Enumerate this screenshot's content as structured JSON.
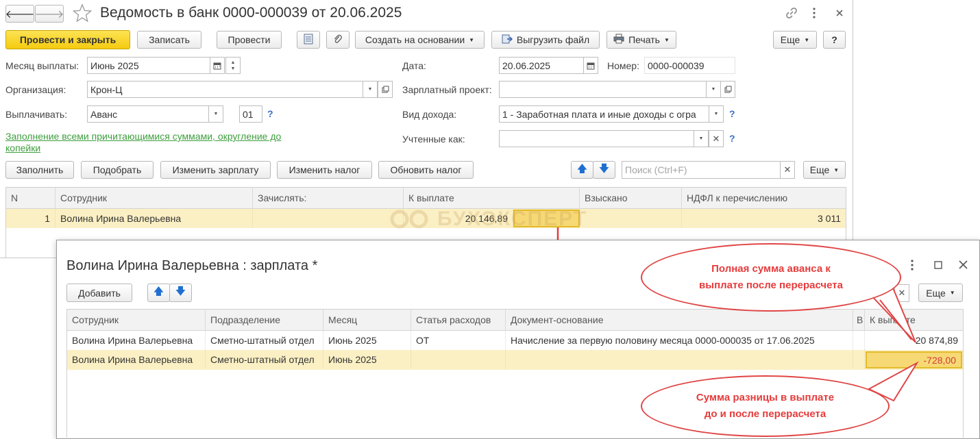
{
  "header": {
    "title": "Ведомость в банк 0000-000039 от 20.06.2025",
    "back_glyph": "🡐",
    "forward_glyph": "🡒"
  },
  "toolbar": {
    "post_close": "Провести и закрыть",
    "save": "Записать",
    "post": "Провести",
    "create_based": "Создать на основании",
    "export_file": "Выгрузить файл",
    "print": "Печать",
    "more": "Еще",
    "help": "?"
  },
  "form": {
    "pay_month_label": "Месяц выплаты:",
    "pay_month_value": "Июнь 2025",
    "org_label": "Организация:",
    "org_value": "Крон-Ц",
    "pay_label": "Выплачивать:",
    "pay_value": "Аванс",
    "pay_code": "01",
    "date_label": "Дата:",
    "date_value": "20.06.2025",
    "number_label": "Номер:",
    "number_value": "0000-000039",
    "salary_project_label": "Зарплатный проект:",
    "income_type_label": "Вид дохода:",
    "income_type_value": "1 - Заработная плата и иные доходы с огра",
    "counted_as_label": "Учтенные как:",
    "fill_link_line1": "Заполнение всеми причитающимися суммами, округление до",
    "fill_link_line2": "копейки",
    "help_q": "?"
  },
  "table_toolbar": {
    "fill": "Заполнить",
    "pick": "Подобрать",
    "change_salary": "Изменить зарплату",
    "change_tax": "Изменить налог",
    "update_tax": "Обновить налог",
    "search_placeholder": "Поиск (Ctrl+F)",
    "more": "Еще"
  },
  "table": {
    "columns": [
      "N",
      "Сотрудник",
      "Зачислять:",
      "К выплате",
      "Взыскано",
      "НДФЛ к перечислению"
    ],
    "rows": [
      {
        "n": "1",
        "employee": "Волина Ирина Валерьевна",
        "credit": "",
        "to_pay": "20 146,89",
        "withheld": "",
        "ndfl": "3 011"
      }
    ]
  },
  "watermark": "БУХЭКСПЕРТ",
  "popup": {
    "title": "Волина Ирина Валерьевна : зарплата *",
    "add": "Добавить",
    "more": "Еще",
    "columns": [
      "Сотрудник",
      "Подразделение",
      "Месяц",
      "Статья расходов",
      "Документ-основание",
      "В",
      "К выплате"
    ],
    "rows": [
      {
        "employee": "Волина Ирина Валерьевна",
        "dept": "Сметно-штатный отдел",
        "month": "Июнь 2025",
        "article": "ОТ",
        "doc": "Начисление за первую половину месяца 0000-000035 от 17.06.2025",
        "b": "",
        "to_pay": "20 874,89"
      },
      {
        "employee": "Волина Ирина Валерьевна",
        "dept": "Сметно-штатный отдел",
        "month": "Июнь 2025",
        "article": "",
        "doc": "",
        "b": "",
        "to_pay": "-728,00"
      }
    ]
  },
  "callouts": {
    "top_line1": "Полная сумма аванса к",
    "top_line2": "выплате после перерасчета",
    "bottom_line1": "Сумма разницы в выплате",
    "bottom_line2": "до и после перерасчета"
  },
  "colors": {
    "accent_yellow": "#f5cb10",
    "row_highlight": "#fbf0c4",
    "link_green": "#3d9e3d",
    "callout_red": "#e04545",
    "arrow_blue": "#1f6fd0"
  }
}
